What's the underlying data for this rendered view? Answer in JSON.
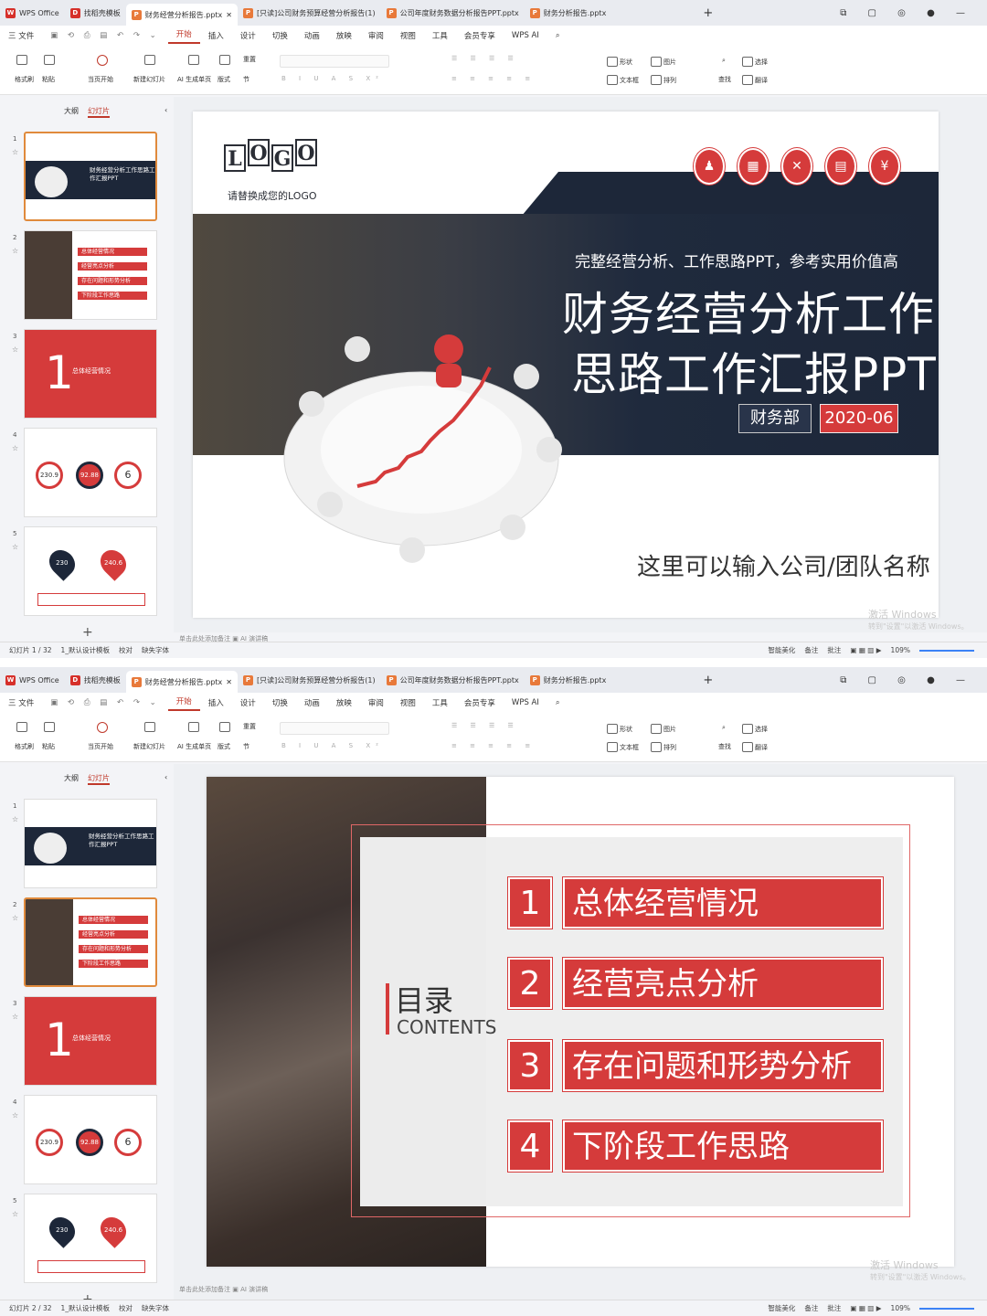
{
  "tabs": [
    {
      "label": "WPS Office",
      "color": "#d6302a",
      "icon": "W"
    },
    {
      "label": "找稻壳模板",
      "color": "#d6302a",
      "icon": "D"
    },
    {
      "label": "财务经营分析报告.pptx",
      "color": "#e8793a",
      "icon": "P"
    },
    {
      "label": "[只读]公司财务预算经营分析报告(1)",
      "color": "#e8793a",
      "icon": "P"
    },
    {
      "label": "公司年度财务数据分析报告PPT.pptx",
      "color": "#e8793a",
      "icon": "P"
    },
    {
      "label": "财务分析报告.pptx",
      "color": "#e8793a",
      "icon": "P"
    }
  ],
  "menu": [
    "三 文件",
    "开始",
    "插入",
    "设计",
    "切换",
    "动画",
    "放映",
    "审阅",
    "视图",
    "工具",
    "会员专享",
    "WPS AI"
  ],
  "ribbon": {
    "format_painter": "格式刷",
    "paste": "粘贴",
    "from_start": "当页开始",
    "new_slide": "新建幻灯片",
    "ai_gen": "AI 生成单页",
    "layout": "版式",
    "section": "节",
    "reset": "重置",
    "shape": "形状",
    "picture": "图片",
    "textbox": "文本框",
    "arrange": "排列",
    "find": "查找",
    "select": "选择",
    "translate": "翻译"
  },
  "sidebar": {
    "outline": "大纲",
    "slides": "幻灯片"
  },
  "thumbs": [
    {
      "num": "1",
      "title": "财务经营分析工作思路工作汇报PPT"
    },
    {
      "num": "2",
      "items": [
        "总体经营情况",
        "经营亮点分析",
        "存在问题和形势分析",
        "下阶段工作思路"
      ]
    },
    {
      "num": "3",
      "big": "1",
      "title": "总体经营情况"
    },
    {
      "num": "4",
      "values": [
        "230.9",
        "92.88",
        "6"
      ]
    },
    {
      "num": "5",
      "values": [
        "230",
        "240.6"
      ]
    }
  ],
  "slide1": {
    "logo": [
      "L",
      "O",
      "G",
      "O"
    ],
    "logo_caption": "请替换成您的LOGO",
    "subtitle": "完整经营分析、工作思路PPT，参考实用价值高",
    "title_line1": "财务经营分析工作",
    "title_line2": "思路工作汇报PPT",
    "dept": "财务部",
    "date": "2020-06",
    "company": "这里可以输入公司/团队名称"
  },
  "slide2": {
    "heading": "目录",
    "heading_en": "CONTENTS",
    "items": [
      {
        "num": "1",
        "label": "总体经营情况"
      },
      {
        "num": "2",
        "label": "经营亮点分析"
      },
      {
        "num": "3",
        "label": "存在问题和形势分析"
      },
      {
        "num": "4",
        "label": "下阶段工作思路"
      }
    ]
  },
  "notes_placeholder": "单击此处添加备注",
  "notes_ai": "AI 演讲稿",
  "watermark": {
    "line1": "激活 Windows",
    "line2": "转到\"设置\"以激活 Windows。"
  },
  "status1": {
    "page": "幻灯片 1 / 32",
    "theme": "1_默认设计模板",
    "proof": "校对",
    "missing_font": "缺失字体",
    "beautify": "智能美化",
    "notes": "备注",
    "comments": "批注",
    "zoom": "109%"
  },
  "status2": {
    "page": "幻灯片 2 / 32",
    "theme": "1_默认设计模板",
    "proof": "校对",
    "missing_font": "缺失字体",
    "beautify": "智能美化",
    "notes": "备注",
    "comments": "批注",
    "zoom": "109%"
  },
  "colors": {
    "accent": "#d53b3b",
    "navy": "#1d2739"
  }
}
